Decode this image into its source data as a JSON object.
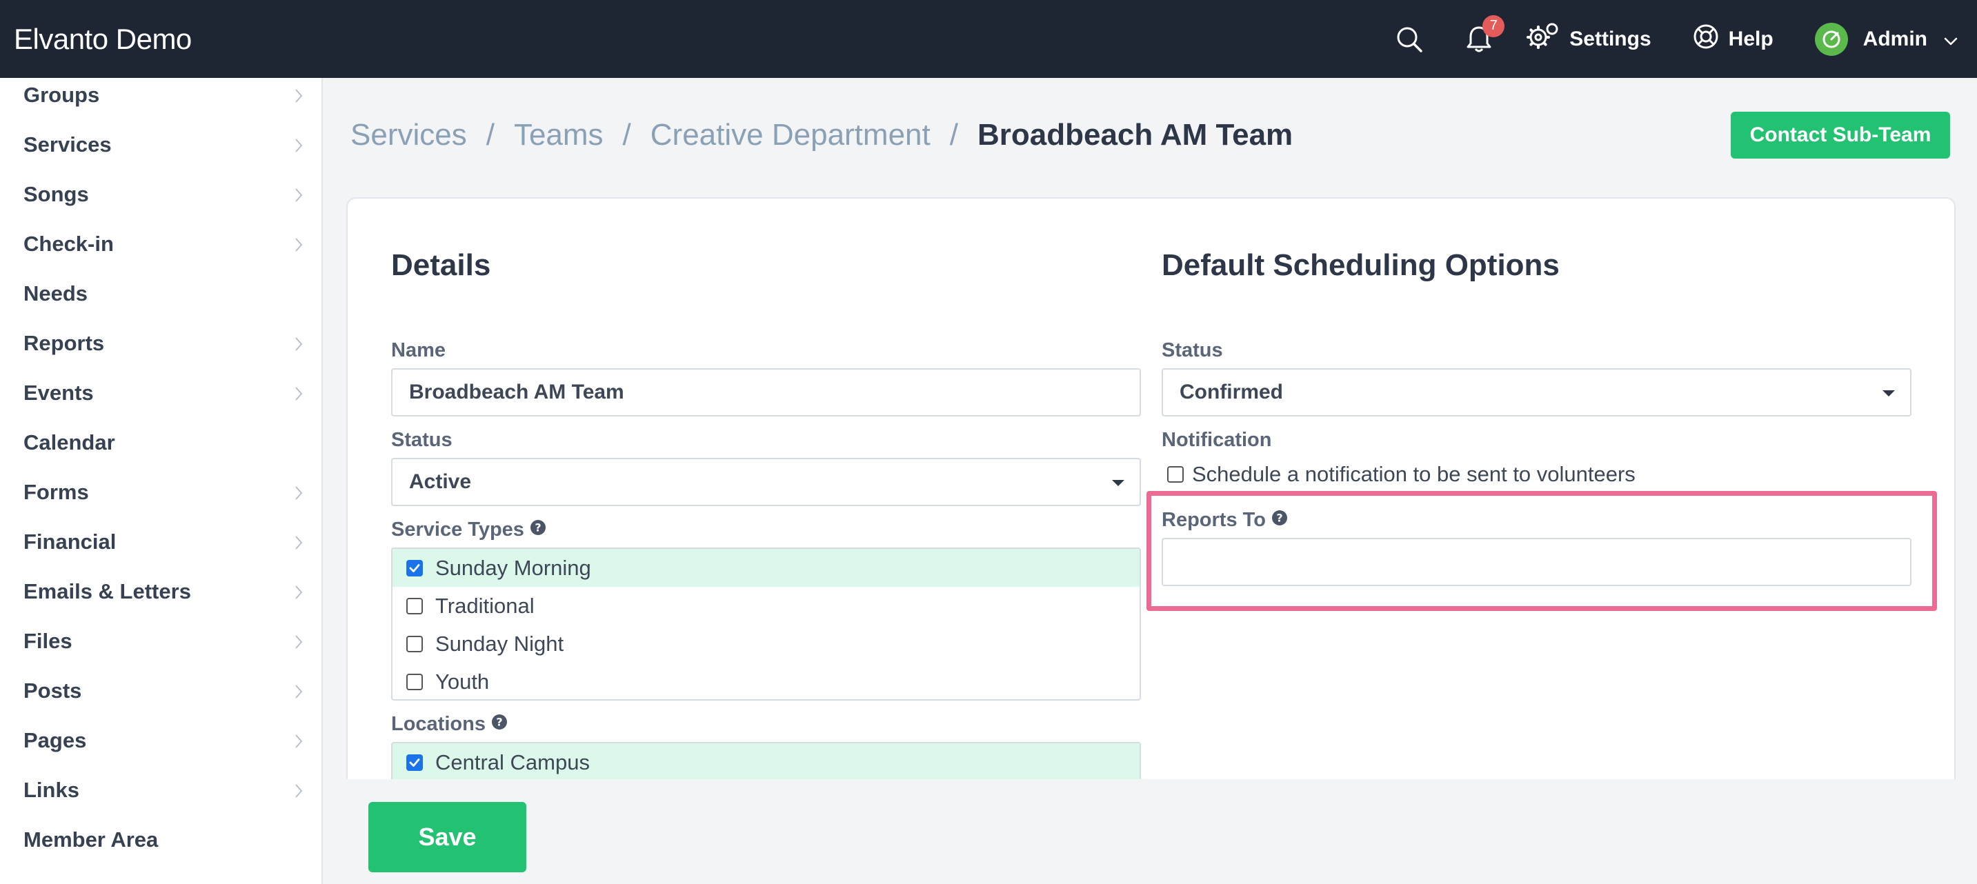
{
  "app": {
    "title": "Elvanto Demo"
  },
  "topbar": {
    "notification_count": "7",
    "settings_label": "Settings",
    "help_label": "Help",
    "user_label": "Admin"
  },
  "sidebar": {
    "items": [
      {
        "label": "Groups",
        "has_arrow": true
      },
      {
        "label": "Services",
        "has_arrow": true
      },
      {
        "label": "Songs",
        "has_arrow": true
      },
      {
        "label": "Check-in",
        "has_arrow": true
      },
      {
        "label": "Needs",
        "has_arrow": false
      },
      {
        "label": "Reports",
        "has_arrow": true
      },
      {
        "label": "Events",
        "has_arrow": true
      },
      {
        "label": "Calendar",
        "has_arrow": false
      },
      {
        "label": "Forms",
        "has_arrow": true
      },
      {
        "label": "Financial",
        "has_arrow": true
      },
      {
        "label": "Emails & Letters",
        "has_arrow": true
      },
      {
        "label": "Files",
        "has_arrow": true
      },
      {
        "label": "Posts",
        "has_arrow": true
      },
      {
        "label": "Pages",
        "has_arrow": true
      },
      {
        "label": "Links",
        "has_arrow": true
      },
      {
        "label": "Member Area",
        "has_arrow": false
      }
    ]
  },
  "breadcrumb": {
    "items": [
      "Services",
      "Teams",
      "Creative Department"
    ],
    "separator": "/",
    "current": "Broadbeach AM Team"
  },
  "header": {
    "contact_button": "Contact Sub-Team"
  },
  "details": {
    "title": "Details",
    "name_label": "Name",
    "name_value": "Broadbeach AM Team",
    "status_label": "Status",
    "status_value": "Active",
    "service_types_label": "Service Types",
    "service_types": [
      {
        "label": "Sunday Morning",
        "checked": true
      },
      {
        "label": "Traditional",
        "checked": false
      },
      {
        "label": "Sunday Night",
        "checked": false
      },
      {
        "label": "Youth",
        "checked": false
      }
    ],
    "locations_label": "Locations",
    "locations": [
      {
        "label": "Central Campus",
        "checked": true
      }
    ]
  },
  "scheduling": {
    "title": "Default Scheduling Options",
    "status_label": "Status",
    "status_value": "Confirmed",
    "notification_label": "Notification",
    "notification_option": "Schedule a notification to be sent to volunteers",
    "notification_checked": false,
    "reports_to_label": "Reports To",
    "reports_to_value": ""
  },
  "footer": {
    "save_label": "Save"
  },
  "colors": {
    "topbar": "#1f2633",
    "accent_green": "#22c272",
    "badge_red": "#e45b5b",
    "highlight_pink": "#ec6b93",
    "selected_row": "#dcf8ea"
  }
}
